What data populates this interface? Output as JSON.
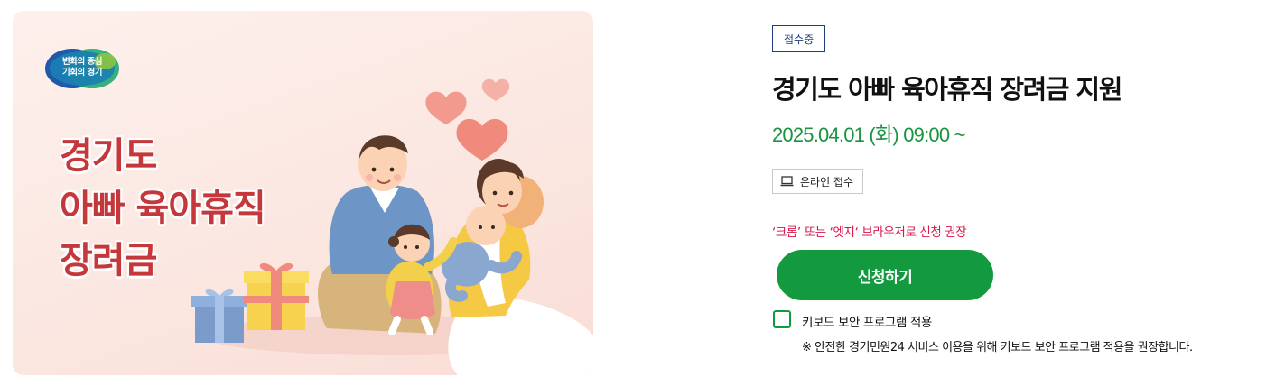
{
  "banner": {
    "logo_line1": "변화의 중심",
    "logo_line2": "기회의 경기",
    "title_line1": "경기도",
    "title_line2": "아빠 육아휴직",
    "title_line3": "장려금"
  },
  "info": {
    "status_badge": "접수중",
    "title": "경기도 아빠 육아휴직 장려금 지원",
    "date": "2025.04.01 (화) 09:00 ~",
    "online_chip": "온라인 접수",
    "notice": "‘크롬’ 또는 ‘엣지‘ 브라우저로 신청 권장",
    "apply_label": "신청하기",
    "keyboard_security_label": "키보드 보안 프로그램 적용",
    "keyboard_security_checked": false,
    "footnote": "※ 안전한 경기민원24 서비스 이용을 위해 키보드 보안 프로그램 적용을 권장합니다."
  },
  "colors": {
    "accent_green": "#139a3e",
    "date_green": "#1a9440",
    "badge_navy": "#1f3d7a",
    "notice_red": "#d6184a",
    "banner_title_red": "#c4383b"
  },
  "icons": {
    "online_chip": "laptop-icon",
    "logo": "gyeonggi-logo"
  }
}
